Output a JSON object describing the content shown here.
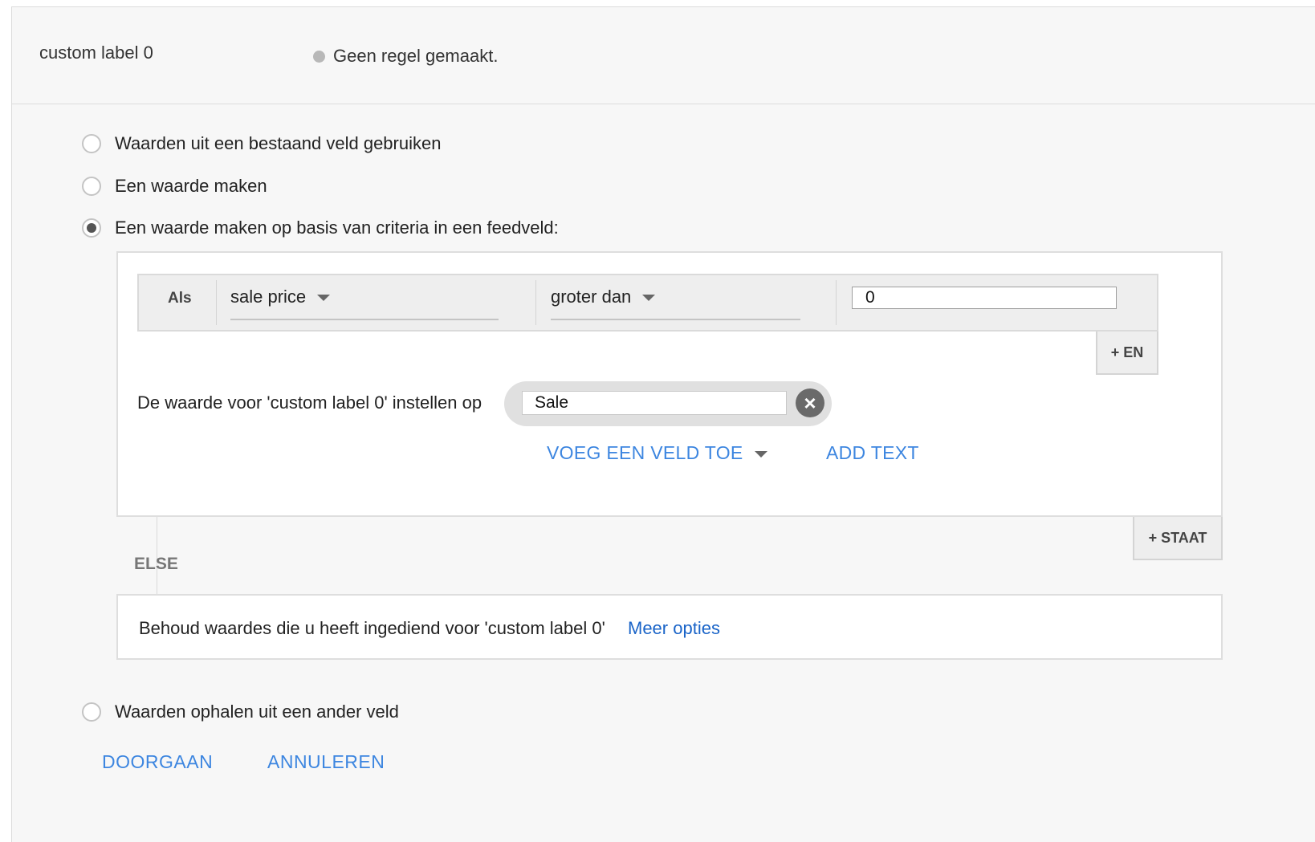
{
  "header": {
    "field_name": "custom label 0",
    "status_text": "Geen regel gemaakt."
  },
  "options": [
    {
      "label": "Waarden uit een bestaand veld gebruiken",
      "checked": false
    },
    {
      "label": "Een waarde maken",
      "checked": false
    },
    {
      "label": "Een waarde maken op basis van criteria in een feedveld:",
      "checked": true
    },
    {
      "label": "Waarden ophalen uit een ander veld",
      "checked": false
    }
  ],
  "condition": {
    "prefix": "Als",
    "field": "sale price",
    "operator": "groter dan",
    "value": "0",
    "and_button": "+ EN"
  },
  "set_value": {
    "label": "De waarde voor 'custom label 0' instellen op",
    "value": "Sale",
    "add_field_button": "VOEG EEN VELD TOE",
    "add_text_button": "ADD TEXT"
  },
  "add_condition_button": "+ STAAT",
  "else": {
    "label": "ELSE",
    "text": "Behoud waardes die u heeft ingediend voor 'custom label 0'",
    "more_options_link": "Meer opties"
  },
  "actions": {
    "continue": "DOORGAAN",
    "cancel": "ANNULEREN"
  },
  "colors": {
    "accent": "#3d86e0",
    "link": "#1a64c8",
    "panel_bg": "#f7f7f7"
  }
}
